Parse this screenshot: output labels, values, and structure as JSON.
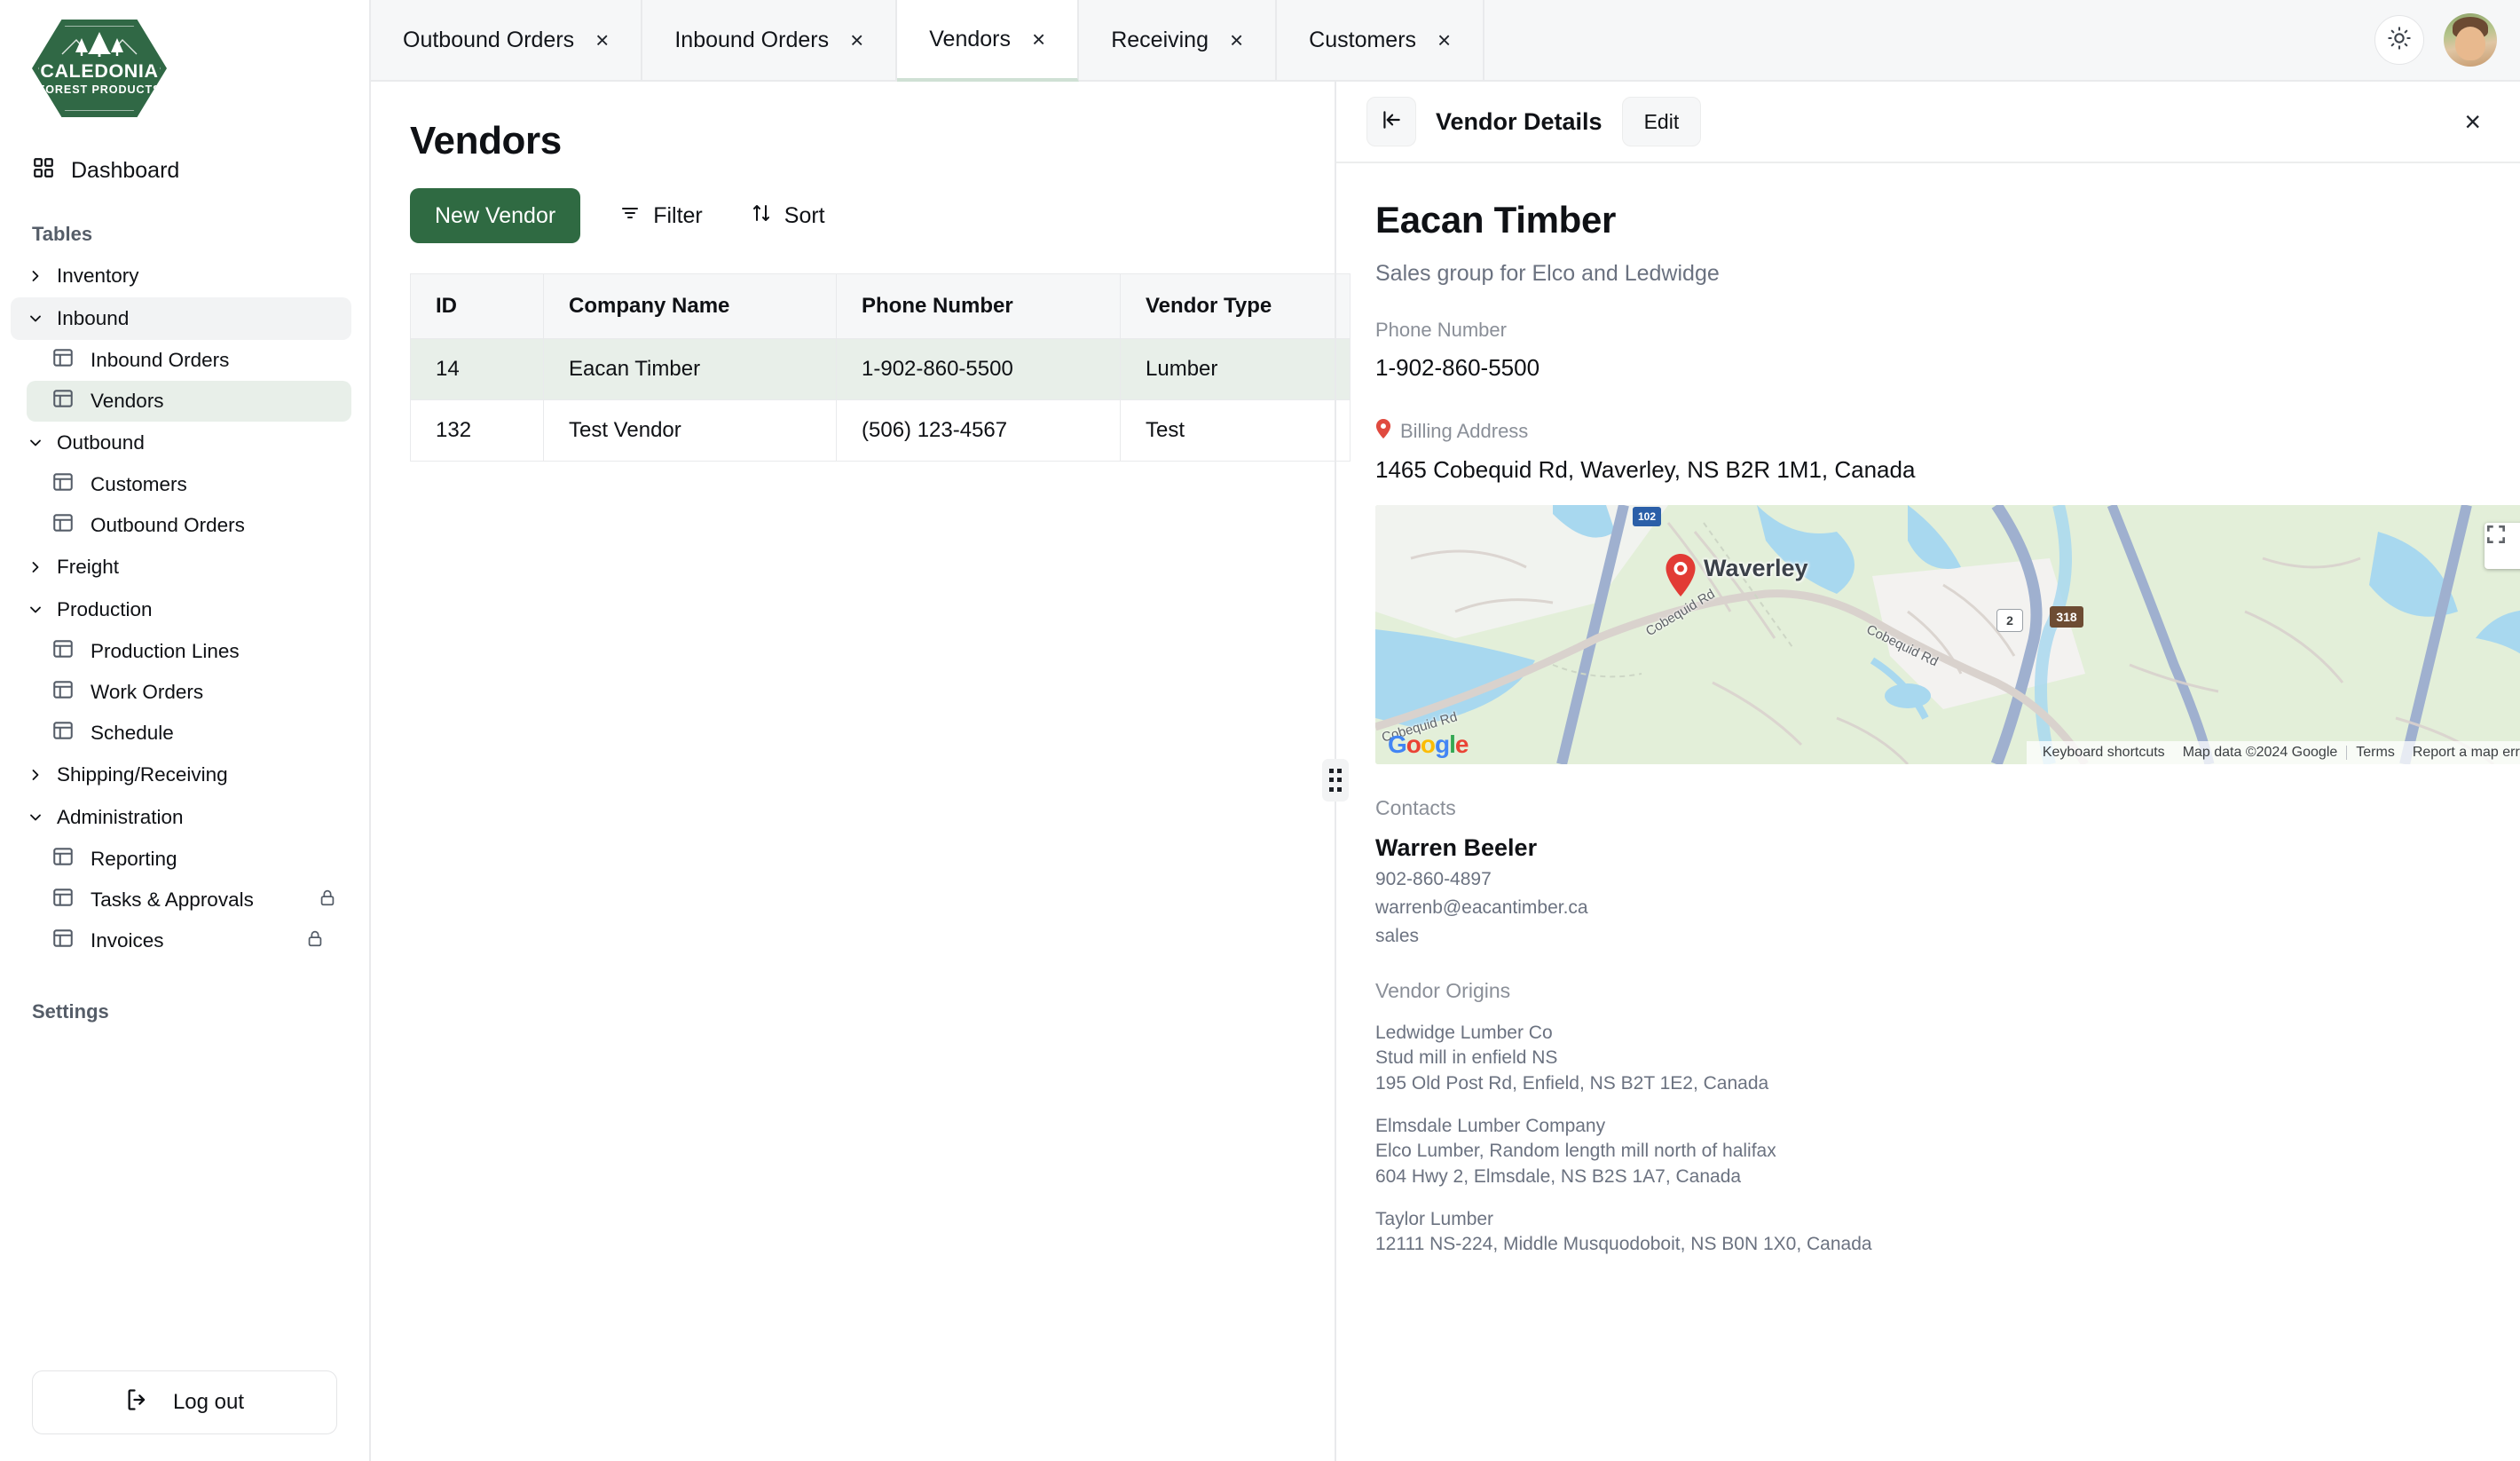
{
  "brand": {
    "logo_line1": "CALEDONIA",
    "logo_line2": "FOREST PRODUCTS",
    "green": "#2f6a42"
  },
  "sidebar": {
    "dashboard_label": "Dashboard",
    "tables_heading": "Tables",
    "settings_heading": "Settings",
    "logout_label": "Log out",
    "groups": [
      {
        "label": "Inventory",
        "expanded": false,
        "children": []
      },
      {
        "label": "Inbound",
        "expanded": true,
        "hovered": true,
        "children": [
          {
            "label": "Inbound Orders",
            "selected": false,
            "locked": false
          },
          {
            "label": "Vendors",
            "selected": true,
            "locked": false
          }
        ]
      },
      {
        "label": "Outbound",
        "expanded": true,
        "children": [
          {
            "label": "Customers",
            "selected": false,
            "locked": false
          },
          {
            "label": "Outbound Orders",
            "selected": false,
            "locked": false
          }
        ]
      },
      {
        "label": "Freight",
        "expanded": false,
        "children": []
      },
      {
        "label": "Production",
        "expanded": true,
        "children": [
          {
            "label": "Production Lines",
            "selected": false,
            "locked": false
          },
          {
            "label": "Work Orders",
            "selected": false,
            "locked": false
          },
          {
            "label": "Schedule",
            "selected": false,
            "locked": false
          }
        ]
      },
      {
        "label": "Shipping/Receiving",
        "expanded": false,
        "children": []
      },
      {
        "label": "Administration",
        "expanded": true,
        "children": [
          {
            "label": "Reporting",
            "selected": false,
            "locked": false
          },
          {
            "label": "Tasks & Approvals",
            "selected": false,
            "locked": true
          },
          {
            "label": "Invoices",
            "selected": false,
            "locked": true
          }
        ]
      }
    ]
  },
  "tabs": [
    {
      "label": "Outbound Orders",
      "active": false
    },
    {
      "label": "Inbound Orders",
      "active": false
    },
    {
      "label": "Vendors",
      "active": true
    },
    {
      "label": "Receiving",
      "active": false
    },
    {
      "label": "Customers",
      "active": false
    }
  ],
  "tab_close_glyph": "×",
  "page": {
    "title": "Vendors",
    "new_button": "New Vendor",
    "filter_button": "Filter",
    "sort_button": "Sort"
  },
  "table": {
    "columns": [
      "ID",
      "Company Name",
      "Phone Number",
      "Vendor Type"
    ],
    "rows": [
      {
        "id": "14",
        "company": "Eacan Timber",
        "phone": "1-902-860-5500",
        "type": "Lumber",
        "selected": true
      },
      {
        "id": "132",
        "company": "Test Vendor",
        "phone": "(506) 123-4567",
        "type": "Test",
        "selected": false
      }
    ]
  },
  "details": {
    "panel_title": "Vendor Details",
    "edit_label": "Edit",
    "close_glyph": "×",
    "vendor_name": "Eacan Timber",
    "vendor_subtitle": "Sales group for Elco and Ledwidge",
    "phone_label": "Phone Number",
    "phone_value": "1-902-860-5500",
    "billing_label": "Billing Address",
    "billing_value": "1465 Cobequid Rd, Waverley, NS B2R 1M1, Canada",
    "contacts_heading": "Contacts",
    "contacts": [
      {
        "name": "Warren Beeler",
        "phone": "902-860-4897",
        "email": "warrenb@eacantimber.ca",
        "role": "sales"
      }
    ],
    "origins_heading": "Vendor Origins",
    "origins": [
      {
        "name": "Ledwidge Lumber Co",
        "note": "Stud mill in enfield NS",
        "address": "195 Old Post Rd, Enfield, NS B2T 1E2, Canada"
      },
      {
        "name": "Elmsdale Lumber Company",
        "note": "Elco Lumber, Random length mill north of halifax",
        "address": "604 Hwy 2, Elmsdale, NS B2S 1A7, Canada"
      },
      {
        "name": "Taylor Lumber",
        "note": "",
        "address": "12111 NS-224, Middle Musquodoboit, NS B0N 1X0, Canada"
      }
    ]
  },
  "map": {
    "city_label": "Waverley",
    "road_labels": [
      "Cobequid Rd",
      "Cobequid Rd",
      "Cobequid Rd"
    ],
    "route_shields": [
      "102",
      "2",
      "318"
    ],
    "google_logo": "Google",
    "attribution": [
      "Keyboard shortcuts",
      "Map data ©2024 Google",
      "Terms",
      "Report a map error"
    ]
  }
}
